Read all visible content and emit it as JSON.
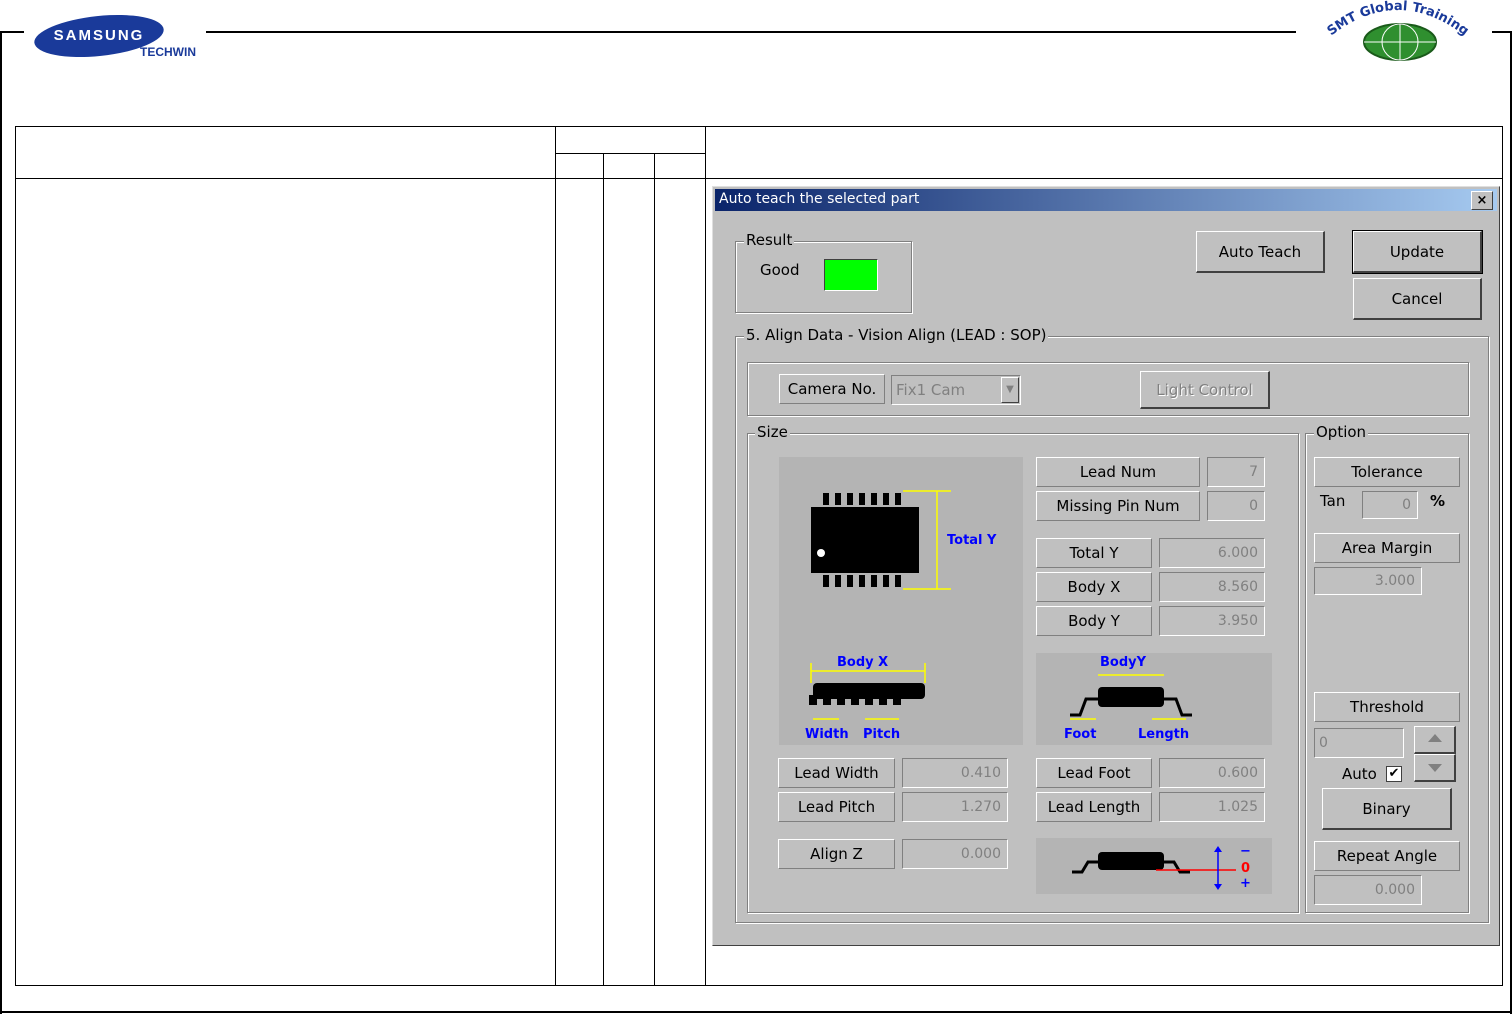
{
  "header": {
    "samsung_logo": "SAMSUNG",
    "techwin_logo": "TECHWIN",
    "smt_logo": "SMT Global Training Center"
  },
  "dialog": {
    "title": "Auto teach the selected part",
    "close_label": "×",
    "result": {
      "group_label": "Result",
      "status_label": "Good",
      "status_color": "#00ff00"
    },
    "buttons": {
      "auto_teach": "Auto Teach",
      "update": "Update",
      "cancel": "Cancel",
      "light_control": "Light Control",
      "binary": "Binary"
    },
    "align_group_label": "5. Align Data - Vision Align (LEAD : SOP)",
    "camera": {
      "label": "Camera No.",
      "selected": "Fix1 Cam"
    },
    "size": {
      "group_label": "Size",
      "lead_num": {
        "label": "Lead Num",
        "value": "7"
      },
      "missing_pin_num": {
        "label": "Missing Pin Num",
        "value": "0"
      },
      "total_y": {
        "label": "Total Y",
        "value": "6.000"
      },
      "body_x": {
        "label": "Body X",
        "value": "8.560"
      },
      "body_y": {
        "label": "Body Y",
        "value": "3.950"
      },
      "lead_width": {
        "label": "Lead Width",
        "value": "0.410"
      },
      "lead_pitch": {
        "label": "Lead Pitch",
        "value": "1.270"
      },
      "lead_foot": {
        "label": "Lead Foot",
        "value": "0.600"
      },
      "lead_length": {
        "label": "Lead Length",
        "value": "1.025"
      },
      "align_z": {
        "label": "Align Z",
        "value": "0.000"
      }
    },
    "diagram_labels": {
      "total_y": "Total Y",
      "body_x": "Body X",
      "width": "Width",
      "pitch": "Pitch",
      "body_y": "BodyY",
      "foot": "Foot",
      "length": "Length",
      "minus": "−",
      "zero": "0",
      "plus": "+"
    },
    "option": {
      "group_label": "Option",
      "tolerance_label": "Tolerance",
      "tan_label": "Tan",
      "tan_value": "0",
      "percent": "%",
      "area_margin_label": "Area Margin",
      "area_margin_value": "3.000",
      "threshold_label": "Threshold",
      "threshold_value": "0",
      "auto_label": "Auto",
      "auto_checked": true,
      "repeat_angle_label": "Repeat Angle",
      "repeat_angle_value": "0.000"
    }
  }
}
